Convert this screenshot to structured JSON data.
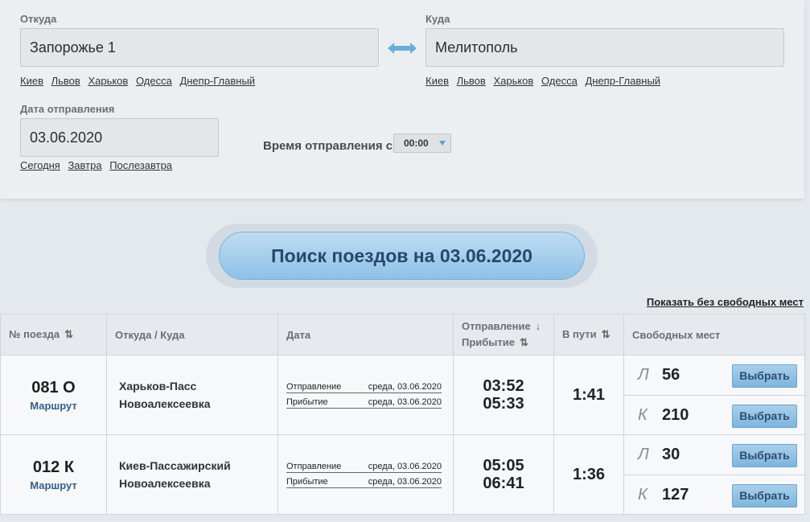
{
  "form": {
    "from_label": "Откуда",
    "from_value": "Запорожье 1",
    "to_label": "Куда",
    "to_value": "Мелитополь",
    "quick_cities": [
      "Киев",
      "Львов",
      "Харьков",
      "Одесса",
      "Днепр-Главный"
    ],
    "date_label": "Дата отправления",
    "date_value": "03.06.2020",
    "quick_dates": [
      "Сегодня",
      "Завтра",
      "Послезавтра"
    ],
    "time_label": "Время отправления с",
    "time_value": "00:00"
  },
  "search_button": "Поиск поездов на 03.06.2020",
  "show_without_seats": "Показать без свободных мест",
  "table": {
    "headers": {
      "train_no": "№ поезда",
      "route": "Откуда / Куда",
      "date": "Дата",
      "departure": "Отправление",
      "arrival": "Прибытие",
      "duration": "В пути",
      "seats": "Свободных мест"
    },
    "rows": [
      {
        "number": "081 О",
        "route_link": "Маршрут",
        "from": "Харьков-Пасс",
        "to": "Новоалексеевка",
        "dep_label": "Отправление",
        "dep_date": "среда, 03.06.2020",
        "arr_label": "Прибытие",
        "arr_date": "среда, 03.06.2020",
        "dep_time": "03:52",
        "arr_time": "05:33",
        "duration": "1:41",
        "seats": [
          {
            "type": "Л",
            "count": "56",
            "button": "Выбрать"
          },
          {
            "type": "К",
            "count": "210",
            "button": "Выбрать"
          }
        ]
      },
      {
        "number": "012 К",
        "route_link": "Маршрут",
        "from": "Киев-Пассажирский",
        "to": "Новоалексеевка",
        "dep_label": "Отправление",
        "dep_date": "среда, 03.06.2020",
        "arr_label": "Прибытие",
        "arr_date": "среда, 03.06.2020",
        "dep_time": "05:05",
        "arr_time": "06:41",
        "duration": "1:36",
        "seats": [
          {
            "type": "Л",
            "count": "30",
            "button": "Выбрать"
          },
          {
            "type": "К",
            "count": "127",
            "button": "Выбрать"
          }
        ]
      }
    ]
  },
  "icons": {
    "swap": "swap-arrows-icon",
    "sort": "sort-arrows-icon",
    "dropdown": "dropdown-triangle-icon"
  },
  "colors": {
    "accent": "#5aa0d0",
    "button_text": "#27486a",
    "link": "#355f88"
  }
}
